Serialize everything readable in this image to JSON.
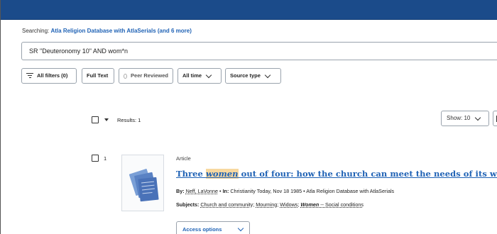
{
  "header": {
    "color": "#1b4b8a"
  },
  "search": {
    "searching_label": "Searching:",
    "databases": "Atla Religion Database with AtlaSerials (and 6 more)",
    "query": "SR \"Deuteronomy 10\" AND wom*n"
  },
  "filters": {
    "all_filters": "All filters (0)",
    "full_text": "Full Text",
    "peer_reviewed": "Peer Reviewed",
    "time": "All time",
    "source_type": "Source type"
  },
  "results": {
    "label": "Results: 1",
    "show": "Show: 10"
  },
  "record": {
    "number": "1",
    "type": "Article",
    "title_before": "Three ",
    "title_highlight": "women",
    "title_after": " out of four: how the church can meet the needs of its widows",
    "by_label": "By:",
    "author": "Neff, LaVonne",
    "in_label": "In:",
    "source": "Christianity Today, Nov 18 1985",
    "database": "Atla Religion Database with AtlaSerials",
    "subjects_label": "Subjects:",
    "subject_1": "Church and community",
    "subject_2": "Mourning",
    "subject_3": "Widows",
    "subject_4_em": "Women",
    "subject_4_rest": " -- Social conditions",
    "access_options": "Access options",
    "highlight_color": "#f7d8a0",
    "link_color": "#1f62b5"
  }
}
